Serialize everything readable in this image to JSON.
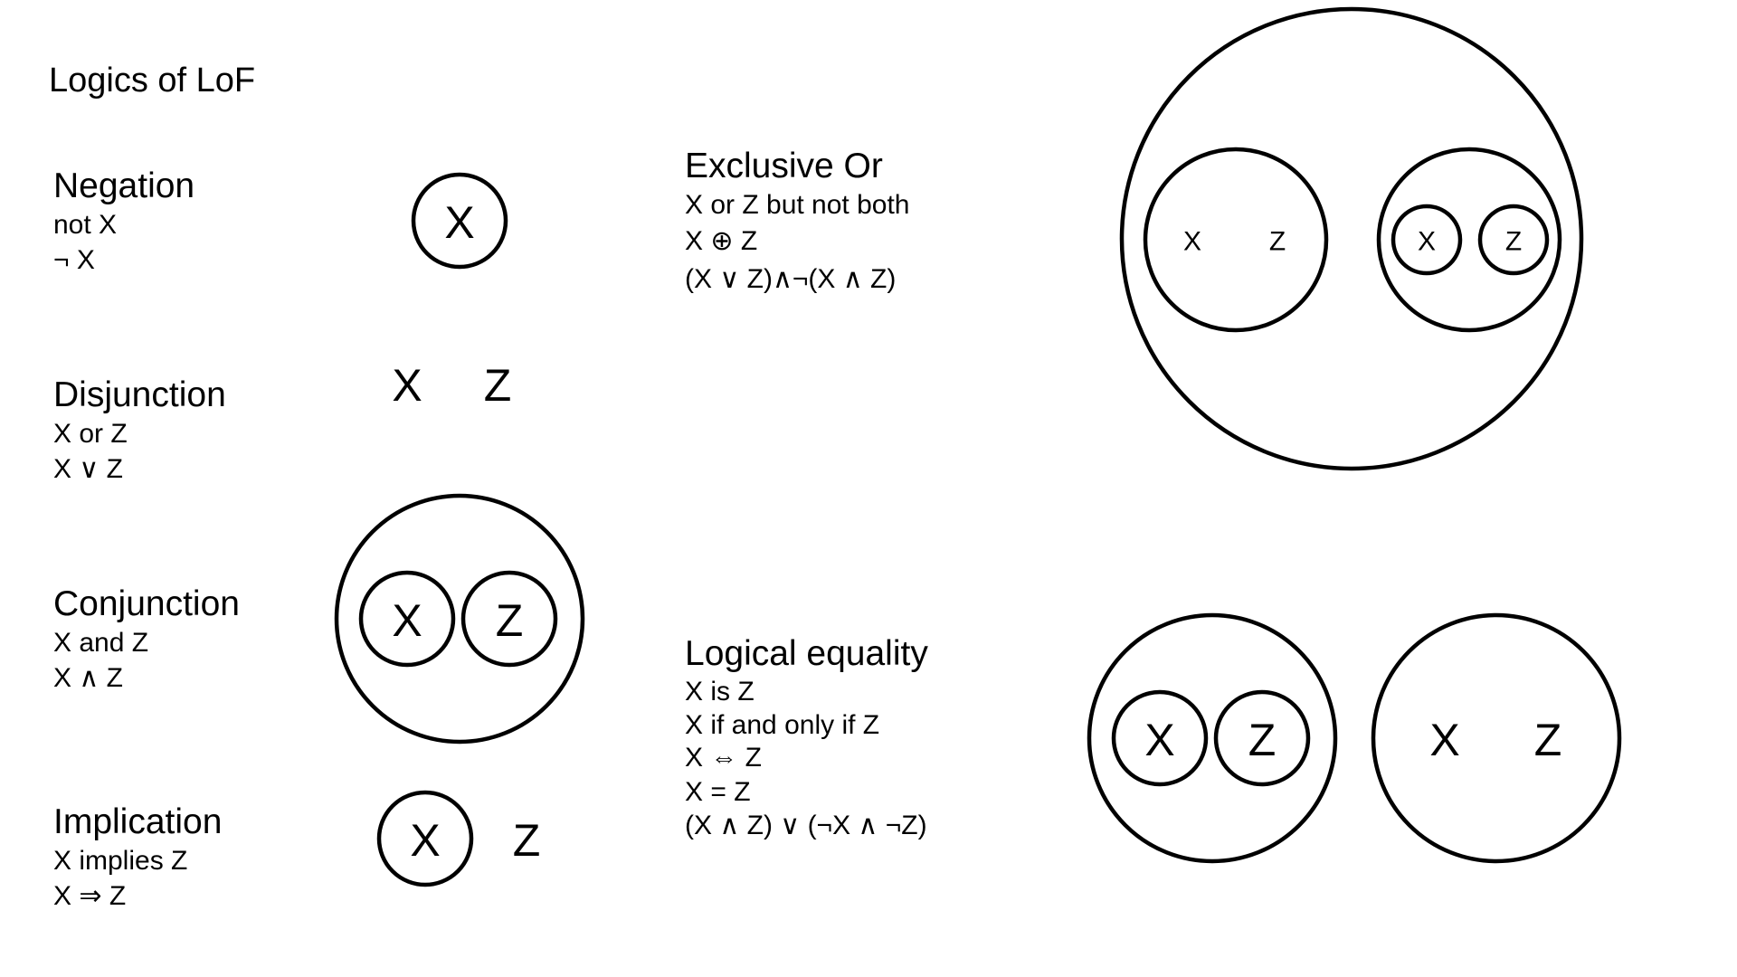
{
  "title": "Logics of LoF",
  "sections": {
    "negation": {
      "heading": "Negation",
      "lines": [
        "not X",
        "¬ X"
      ]
    },
    "disjunction": {
      "heading": "Disjunction",
      "lines": [
        "X or Z",
        "X ∨ Z"
      ]
    },
    "conjunction": {
      "heading": "Conjunction",
      "lines": [
        "X and Z",
        "X ∧ Z"
      ]
    },
    "implication": {
      "heading": "Implication",
      "lines": [
        "X implies Z",
        "X ⇒ Z"
      ]
    },
    "exclusive_or": {
      "heading": "Exclusive Or",
      "lines": [
        "X or Z but not both",
        "X ⊕ Z",
        "(X ∨ Z)∧¬(X ∧ Z)"
      ]
    },
    "logical_equality": {
      "heading": "Logical equality",
      "lines": [
        "X is Z",
        "X if and only if Z",
        "X ⇔ Z",
        "X = Z",
        "(X ∧ Z) ∨ (¬X ∧ ¬Z)"
      ]
    }
  },
  "diagram_labels": {
    "x": "X",
    "z": "Z"
  }
}
